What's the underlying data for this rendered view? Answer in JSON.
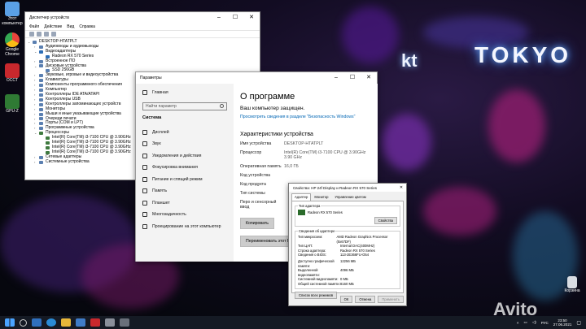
{
  "desktop": {
    "icons": [
      {
        "label": "Этот компьютер",
        "color": "#5aa0e6"
      },
      {
        "label": "Google Chrome",
        "color": "#e8453c"
      },
      {
        "label": "OCCT",
        "color": "#c8282d"
      },
      {
        "label": "GPU-Z",
        "color": "#2f7a34"
      }
    ],
    "recycle_label": "Корзина",
    "wall_text": [
      "kt",
      "TOKYO"
    ],
    "watermark": "Avito"
  },
  "device_manager": {
    "title": "Диспетчер устройств",
    "menu": [
      "Файл",
      "Действие",
      "Вид",
      "Справка"
    ],
    "tree": [
      {
        "text": "DESKTOP-HTATPLT",
        "level": 0,
        "arrow": "⌄",
        "icon": "pc"
      },
      {
        "text": "Аудиовходы и аудиовыходы",
        "level": 1,
        "arrow": "›",
        "icon": "dev"
      },
      {
        "text": "Видеоадаптеры",
        "level": 1,
        "arrow": "⌄",
        "icon": "disp"
      },
      {
        "text": "Radeon RX 570 Series",
        "level": 2,
        "arrow": "",
        "icon": "disp"
      },
      {
        "text": "Встроенное ПО",
        "level": 1,
        "arrow": "›",
        "icon": "dev"
      },
      {
        "text": "Дисковые устройства",
        "level": 1,
        "arrow": "⌄",
        "icon": "dev"
      },
      {
        "text": "SSD 256GB",
        "level": 2,
        "arrow": "",
        "icon": "dev"
      },
      {
        "text": "Звуковые, игровые и видеоустройства",
        "level": 1,
        "arrow": "›",
        "icon": "dev"
      },
      {
        "text": "Клавиатуры",
        "level": 1,
        "arrow": "›",
        "icon": "dev"
      },
      {
        "text": "Компоненты программного обеспечения",
        "level": 1,
        "arrow": "›",
        "icon": "dev"
      },
      {
        "text": "Компьютер",
        "level": 1,
        "arrow": "›",
        "icon": "dev"
      },
      {
        "text": "Контроллеры IDE ATA/ATAPI",
        "level": 1,
        "arrow": "›",
        "icon": "dev"
      },
      {
        "text": "Контроллеры USB",
        "level": 1,
        "arrow": "›",
        "icon": "dev"
      },
      {
        "text": "Контроллеры запоминающих устройств",
        "level": 1,
        "arrow": "›",
        "icon": "dev"
      },
      {
        "text": "Мониторы",
        "level": 1,
        "arrow": "›",
        "icon": "dev"
      },
      {
        "text": "Мыши и иные указывающие устройства",
        "level": 1,
        "arrow": "›",
        "icon": "dev"
      },
      {
        "text": "Очереди печати",
        "level": 1,
        "arrow": "›",
        "icon": "dev"
      },
      {
        "text": "Порты (COM и LPT)",
        "level": 1,
        "arrow": "›",
        "icon": "dev"
      },
      {
        "text": "Программные устройства",
        "level": 1,
        "arrow": "›",
        "icon": "dev"
      },
      {
        "text": "Процессоры",
        "level": 1,
        "arrow": "⌄",
        "icon": "chip"
      },
      {
        "text": "Intel(R) Core(TM) i3-7100 CPU @ 3.90GHz",
        "level": 2,
        "arrow": "",
        "icon": "chip"
      },
      {
        "text": "Intel(R) Core(TM) i3-7100 CPU @ 3.90GHz",
        "level": 2,
        "arrow": "",
        "icon": "chip"
      },
      {
        "text": "Intel(R) Core(TM) i3-7100 CPU @ 3.90GHz",
        "level": 2,
        "arrow": "",
        "icon": "chip"
      },
      {
        "text": "Intel(R) Core(TM) i3-7100 CPU @ 3.90GHz",
        "level": 2,
        "arrow": "",
        "icon": "chip"
      },
      {
        "text": "Сетевые адаптеры",
        "level": 1,
        "arrow": "›",
        "icon": "dev"
      },
      {
        "text": "Системные устройства",
        "level": 1,
        "arrow": "›",
        "icon": "dev"
      }
    ]
  },
  "settings": {
    "title": "Параметры",
    "home": "Главная",
    "search_placeholder": "Найти параметр",
    "section": "Система",
    "nav": [
      "Дисплей",
      "Звук",
      "Уведомления и действия",
      "Фокусировка внимания",
      "Питание и спящий режим",
      "Память",
      "Планшет",
      "Многозадачность",
      "Проецирование на этот компьютер"
    ],
    "heading": "О программе",
    "protected": "Ваш компьютер защищен.",
    "security_link": "Просмотреть сведения в разделе \"Безопасность Windows\"",
    "specs_heading": "Характеристики устройства",
    "specs": [
      {
        "k": "Имя устройства",
        "v": "DESKTOP-HTATPLT"
      },
      {
        "k": "Процессор",
        "v": "Intel(R) Core(TM) i3-7100 CPU @ 3.90GHz   3.90 GHz"
      },
      {
        "k": "Оперативная память",
        "v": "16,0 ГБ"
      },
      {
        "k": "Код устройства",
        "v": ""
      },
      {
        "k": "Код продукта",
        "v": ""
      },
      {
        "k": "Тип системы",
        "v": ""
      },
      {
        "k": "Перо и сенсорный ввод",
        "v": ""
      }
    ],
    "copy_btn": "Копировать",
    "rename_btn": "Переименовать этот ПК"
  },
  "props": {
    "title": "Свойства: HP 24f Display и Radeon RX 570 Series",
    "tabs": [
      "Адаптер",
      "Монитор",
      "Управление цветом"
    ],
    "adapter_type_label": "Тип адаптера",
    "adapter_name": "Radeon RX 570 Series",
    "props_btn": "Свойства",
    "info_label": "Сведения об адаптере",
    "info": [
      {
        "k": "Тип микросхем:",
        "v": "AMD Radeon Graphics Processor (0x67DF)"
      },
      {
        "k": "Тип ЦАП:",
        "v": "Internal DAC(400MHz)"
      },
      {
        "k": "Строка адаптера:",
        "v": "Radeon RX 570 Series"
      },
      {
        "k": "Сведения о BIOS:",
        "v": "113-2E366FU-O54"
      }
    ],
    "mem": [
      {
        "k": "Доступно графической памяти:",
        "v": "12256 МБ"
      },
      {
        "k": "Выделенной видеопамяти:",
        "v": "4096 МБ"
      },
      {
        "k": "Системной видеопамяти:",
        "v": "0 МБ"
      },
      {
        "k": "Общей системной памяти:",
        "v": "8160 МБ"
      }
    ],
    "list_modes": "Список всех режимов",
    "ok": "ОК",
    "cancel": "Отмена",
    "apply": "Применить"
  },
  "taskbar": {
    "lang": "РУС",
    "time": "23:50",
    "date": "27.06.2021"
  }
}
